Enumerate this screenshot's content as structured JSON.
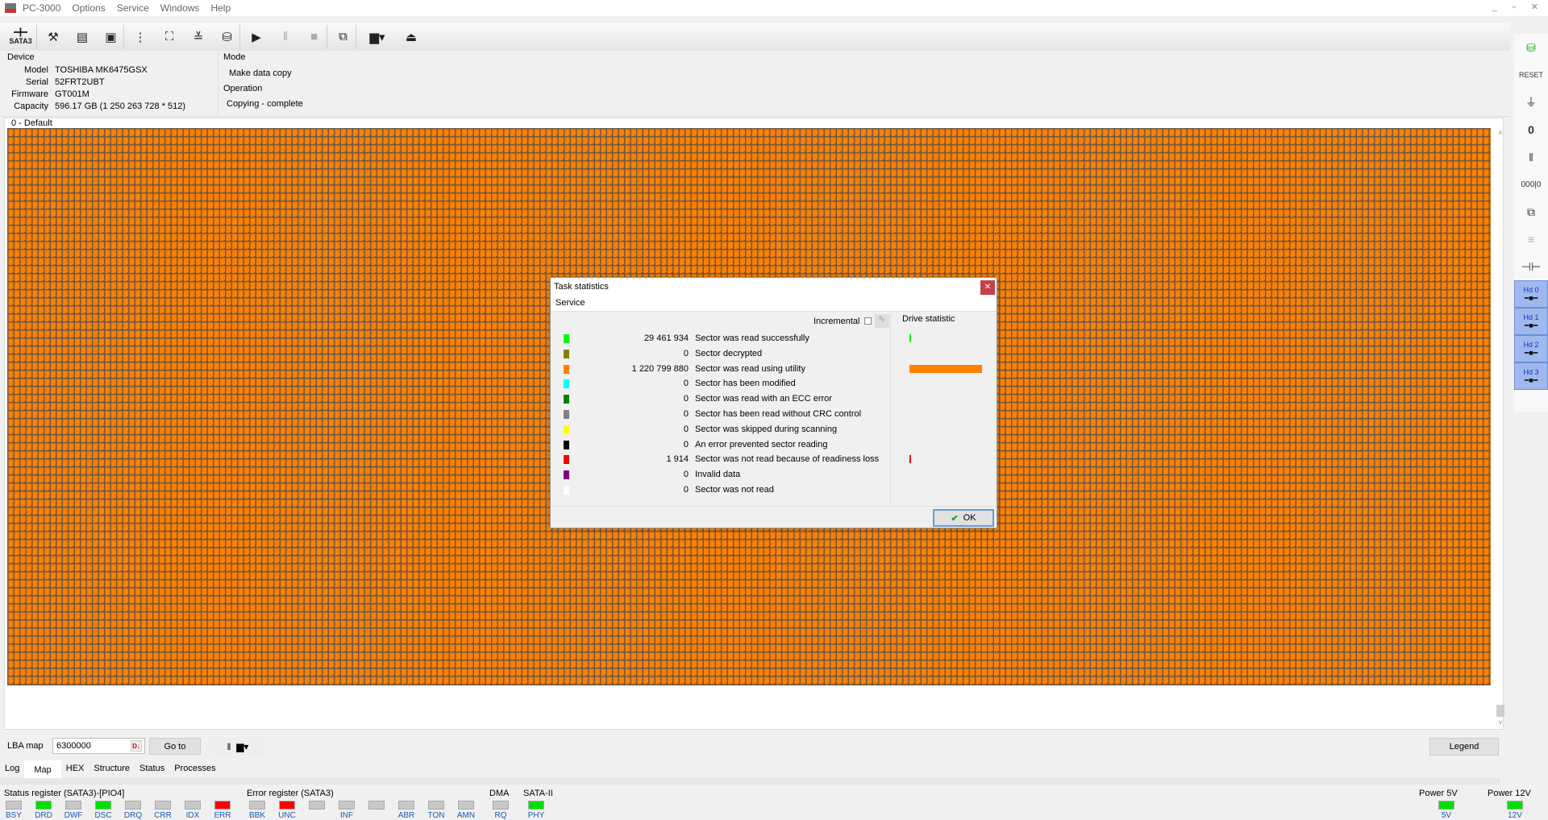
{
  "app": {
    "title": "PC-3000",
    "menu": [
      "Options",
      "Service",
      "Windows",
      "Help"
    ]
  },
  "toolbar": {
    "sata_label": "SATA3"
  },
  "device": {
    "section": "Device",
    "model_label": "Model",
    "model": "TOSHIBA MK6475GSX",
    "serial_label": "Serial",
    "serial": "52FRT2UBT",
    "firmware_label": "Firmware",
    "firmware": "GT001M",
    "capacity_label": "Capacity",
    "capacity": "596.17 GB (1 250 263 728 * 512)"
  },
  "mode": {
    "section": "Mode",
    "value": "Make data copy",
    "operation_label": "Operation",
    "operation": "Copying - complete"
  },
  "map": {
    "title": "0 - Default",
    "lba_label": "LBA map",
    "lba_value": "6300000",
    "goto_label": "Go to",
    "legend_label": "Legend"
  },
  "tabs": [
    "Log",
    "Map",
    "HEX",
    "Structure",
    "Status",
    "Processes"
  ],
  "status_register": {
    "title": "Status register (SATA3)-[PIO4]",
    "leds": [
      {
        "l": "BSY",
        "s": "off"
      },
      {
        "l": "DRD",
        "s": "green"
      },
      {
        "l": "DWF",
        "s": "off"
      },
      {
        "l": "DSC",
        "s": "green"
      },
      {
        "l": "DRQ",
        "s": "off"
      },
      {
        "l": "CRR",
        "s": "off"
      },
      {
        "l": "IDX",
        "s": "off"
      },
      {
        "l": "ERR",
        "s": "red"
      }
    ]
  },
  "error_register": {
    "title": "Error register (SATA3)",
    "leds": [
      {
        "l": "BBK",
        "s": "off"
      },
      {
        "l": "UNC",
        "s": "red"
      },
      {
        "l": "",
        "s": "off"
      },
      {
        "l": "INF",
        "s": "off"
      },
      {
        "l": "",
        "s": "off"
      },
      {
        "l": "ABR",
        "s": "off"
      },
      {
        "l": "TON",
        "s": "off"
      },
      {
        "l": "AMN",
        "s": "off"
      }
    ]
  },
  "dma": {
    "title": "DMA",
    "led": "RQ"
  },
  "sata": {
    "title": "SATA-II",
    "led": "PHY"
  },
  "power5": {
    "title": "Power 5V",
    "led": "5V"
  },
  "power12": {
    "title": "Power 12V",
    "led": "12V"
  },
  "right_toolbar": {
    "heads": [
      "Hd 0",
      "Hd 1",
      "Hd 2",
      "Hd 3"
    ]
  },
  "dialog": {
    "title": "Task statistics",
    "menu": "Service",
    "incremental_label": "Incremental",
    "drive_stat_label": "Drive statistic",
    "ok_label": "OK",
    "rows": [
      {
        "color": "#00ff00",
        "count": "29 461 934",
        "desc": "Sector was read successfully",
        "share": 0.024
      },
      {
        "color": "#808000",
        "count": "0",
        "desc": "Sector decrypted",
        "share": 0
      },
      {
        "color": "#ff8000",
        "count": "1 220 799 880",
        "desc": "Sector was read using utility",
        "share": 0.976
      },
      {
        "color": "#00ffff",
        "count": "0",
        "desc": "Sector has been modified",
        "share": 0
      },
      {
        "color": "#008000",
        "count": "0",
        "desc": "Sector was read with an ECC error",
        "share": 0
      },
      {
        "color": "#808080",
        "count": "0",
        "desc": "Sector has been read without CRC control",
        "share": 0
      },
      {
        "color": "#ffff00",
        "count": "0",
        "desc": "Sector was skipped during scanning",
        "share": 0
      },
      {
        "color": "#000000",
        "count": "0",
        "desc": "An error prevented sector reading",
        "share": 0
      },
      {
        "color": "#ff0000",
        "count": "1 914",
        "desc": "Sector was not read because of readiness loss",
        "share": 1.5e-06
      },
      {
        "color": "#800080",
        "count": "0",
        "desc": "Invalid data",
        "share": 0
      },
      {
        "color": "#ffffff",
        "count": "0",
        "desc": "Sector was not read",
        "share": 0
      }
    ]
  }
}
